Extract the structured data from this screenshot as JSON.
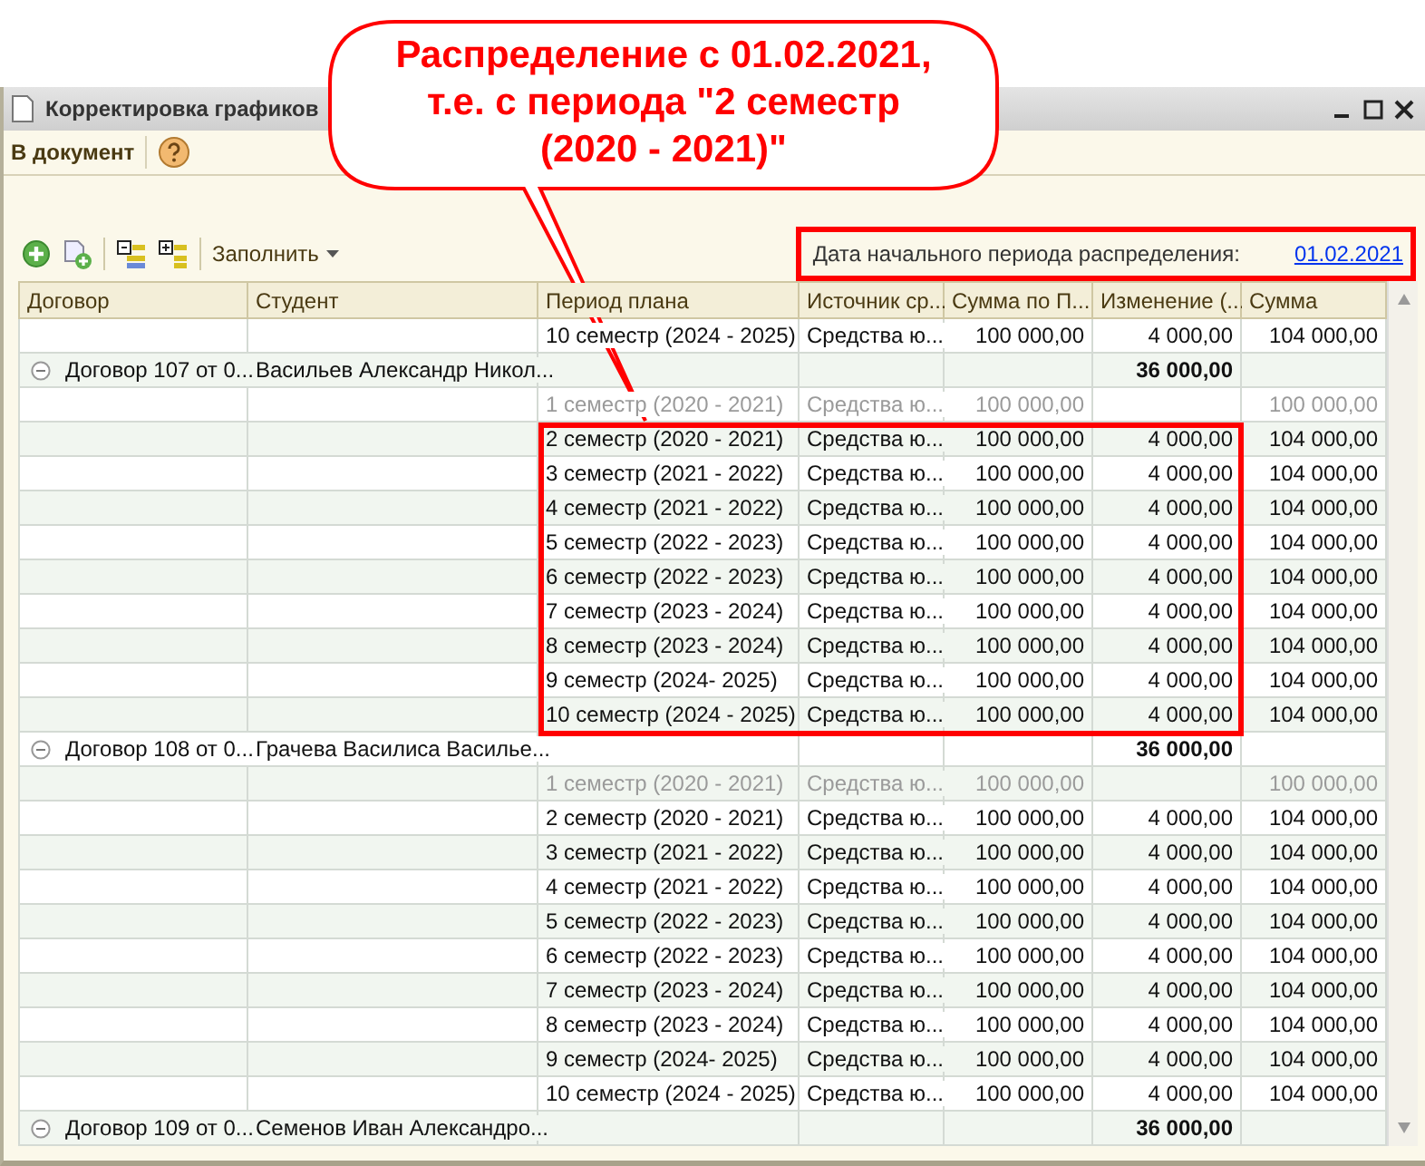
{
  "window": {
    "title": "Корректировка графиков"
  },
  "command_bar": {
    "button": "В документ"
  },
  "toolbar": {
    "fill_menu": "Заполнить"
  },
  "start_date": {
    "label": "Дата начального периода распределения:",
    "value": "01.02.2021"
  },
  "table": {
    "columns": [
      "Договор",
      "Студент",
      "Период плана",
      "Источник ср...",
      "Сумма по П...",
      "Изменение (...",
      "Сумма"
    ],
    "rows": [
      {
        "kind": "row",
        "disabled": false,
        "period": "10 семестр (2024 - 2025)",
        "source": "Средства ю...",
        "plan_sum": "100 000,00",
        "change": "4 000,00",
        "sum": "104 000,00"
      },
      {
        "kind": "group",
        "expanded": true,
        "contract": "Договор 107 от 0...",
        "student": "Васильев Александр Никол...",
        "change": "36 000,00"
      },
      {
        "kind": "row",
        "disabled": true,
        "period": "1 семестр (2020 - 2021)",
        "source": "Средства ю...",
        "plan_sum": "100 000,00",
        "sum": "100 000,00"
      },
      {
        "kind": "row",
        "disabled": false,
        "period": "2 семестр (2020 - 2021)",
        "source": "Средства ю...",
        "plan_sum": "100 000,00",
        "change": "4 000,00",
        "sum": "104 000,00"
      },
      {
        "kind": "row",
        "disabled": false,
        "period": "3 семестр (2021 - 2022)",
        "source": "Средства ю...",
        "plan_sum": "100 000,00",
        "change": "4 000,00",
        "sum": "104 000,00"
      },
      {
        "kind": "row",
        "disabled": false,
        "period": "4 семестр (2021 - 2022)",
        "source": "Средства ю...",
        "plan_sum": "100 000,00",
        "change": "4 000,00",
        "sum": "104 000,00"
      },
      {
        "kind": "row",
        "disabled": false,
        "period": "5 семестр (2022 - 2023)",
        "source": "Средства ю...",
        "plan_sum": "100 000,00",
        "change": "4 000,00",
        "sum": "104 000,00"
      },
      {
        "kind": "row",
        "disabled": false,
        "period": "6 семестр (2022 - 2023)",
        "source": "Средства ю...",
        "plan_sum": "100 000,00",
        "change": "4 000,00",
        "sum": "104 000,00"
      },
      {
        "kind": "row",
        "disabled": false,
        "period": "7 семестр (2023 - 2024)",
        "source": "Средства ю...",
        "plan_sum": "100 000,00",
        "change": "4 000,00",
        "sum": "104 000,00"
      },
      {
        "kind": "row",
        "disabled": false,
        "period": "8 семестр (2023 - 2024)",
        "source": "Средства ю...",
        "plan_sum": "100 000,00",
        "change": "4 000,00",
        "sum": "104 000,00"
      },
      {
        "kind": "row",
        "disabled": false,
        "period": "9 семестр (2024- 2025)",
        "source": "Средства ю...",
        "plan_sum": "100 000,00",
        "change": "4 000,00",
        "sum": "104 000,00"
      },
      {
        "kind": "row",
        "disabled": false,
        "period": "10 семестр (2024 - 2025)",
        "source": "Средства ю...",
        "plan_sum": "100 000,00",
        "change": "4 000,00",
        "sum": "104 000,00"
      },
      {
        "kind": "group",
        "expanded": true,
        "contract": "Договор 108 от 0...",
        "student": "Грачева Василиса Василье...",
        "change": "36 000,00"
      },
      {
        "kind": "row",
        "disabled": true,
        "period": "1 семестр (2020 - 2021)",
        "source": "Средства ю...",
        "plan_sum": "100 000,00",
        "sum": "100 000,00"
      },
      {
        "kind": "row",
        "disabled": false,
        "period": "2 семестр (2020 - 2021)",
        "source": "Средства ю...",
        "plan_sum": "100 000,00",
        "change": "4 000,00",
        "sum": "104 000,00"
      },
      {
        "kind": "row",
        "disabled": false,
        "period": "3 семестр (2021 - 2022)",
        "source": "Средства ю...",
        "plan_sum": "100 000,00",
        "change": "4 000,00",
        "sum": "104 000,00"
      },
      {
        "kind": "row",
        "disabled": false,
        "period": "4 семестр (2021 - 2022)",
        "source": "Средства ю...",
        "plan_sum": "100 000,00",
        "change": "4 000,00",
        "sum": "104 000,00"
      },
      {
        "kind": "row",
        "disabled": false,
        "period": "5 семестр (2022 - 2023)",
        "source": "Средства ю...",
        "plan_sum": "100 000,00",
        "change": "4 000,00",
        "sum": "104 000,00"
      },
      {
        "kind": "row",
        "disabled": false,
        "period": "6 семестр (2022 - 2023)",
        "source": "Средства ю...",
        "plan_sum": "100 000,00",
        "change": "4 000,00",
        "sum": "104 000,00"
      },
      {
        "kind": "row",
        "disabled": false,
        "period": "7 семестр (2023 - 2024)",
        "source": "Средства ю...",
        "plan_sum": "100 000,00",
        "change": "4 000,00",
        "sum": "104 000,00"
      },
      {
        "kind": "row",
        "disabled": false,
        "period": "8 семестр (2023 - 2024)",
        "source": "Средства ю...",
        "plan_sum": "100 000,00",
        "change": "4 000,00",
        "sum": "104 000,00"
      },
      {
        "kind": "row",
        "disabled": false,
        "period": "9 семестр (2024- 2025)",
        "source": "Средства ю...",
        "plan_sum": "100 000,00",
        "change": "4 000,00",
        "sum": "104 000,00"
      },
      {
        "kind": "row",
        "disabled": false,
        "period": "10 семестр (2024 - 2025)",
        "source": "Средства ю...",
        "plan_sum": "100 000,00",
        "change": "4 000,00",
        "sum": "104 000,00"
      },
      {
        "kind": "group",
        "expanded": true,
        "contract": "Договор 109 от 0...",
        "student": "Семенов Иван Александро...",
        "change": "36 000,00"
      }
    ]
  },
  "callout": {
    "lines": [
      "Распределение с 01.02.2021,",
      "т.е. с периода \"2 семестр",
      "(2020 - 2021)\""
    ]
  }
}
